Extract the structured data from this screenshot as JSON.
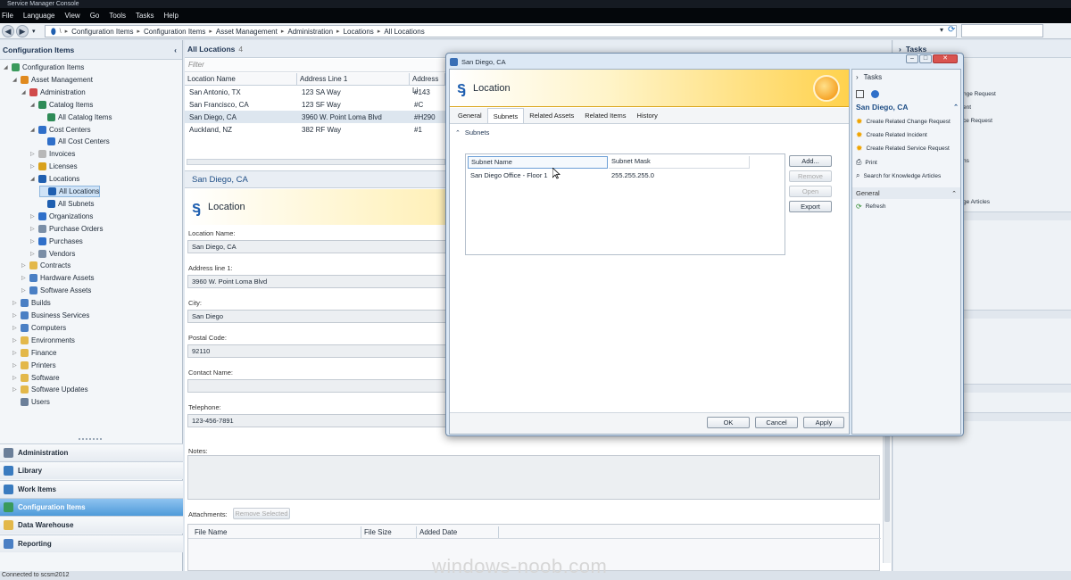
{
  "window": {
    "title": "Service Manager Console"
  },
  "menu": [
    "File",
    "Language",
    "View",
    "Go",
    "Tools",
    "Tasks",
    "Help"
  ],
  "breadcrumb": [
    "Configuration Items",
    "Configuration Items",
    "Asset Management",
    "Administration",
    "Locations",
    "All Locations"
  ],
  "left_pane": {
    "title": "Configuration Items",
    "tree": [
      {
        "label": "Configuration Items",
        "level": 0,
        "icon": "ci-icon"
      },
      {
        "label": "Asset Management",
        "level": 1,
        "icon": "asset-icon"
      },
      {
        "label": "Administration",
        "level": 2,
        "icon": "admin-icon"
      },
      {
        "label": "Catalog Items",
        "level": 3,
        "icon": "catalog-icon"
      },
      {
        "label": "All Catalog Items",
        "level": 4,
        "icon": "catalog-icon"
      },
      {
        "label": "Cost Centers",
        "level": 3,
        "icon": "cost-center-icon"
      },
      {
        "label": "All Cost Centers",
        "level": 4,
        "icon": "cost-center-icon"
      },
      {
        "label": "Invoices",
        "level": 3,
        "icon": "invoice-icon"
      },
      {
        "label": "Licenses",
        "level": 3,
        "icon": "license-icon"
      },
      {
        "label": "Locations",
        "level": 3,
        "icon": "location-icon"
      },
      {
        "label": "All Locations",
        "level": 4,
        "icon": "location-icon",
        "selected": true
      },
      {
        "label": "All Subnets",
        "level": 4,
        "icon": "location-icon"
      },
      {
        "label": "Organizations",
        "level": 3,
        "icon": "organization-icon"
      },
      {
        "label": "Purchase Orders",
        "level": 3,
        "icon": "purchase-order-icon"
      },
      {
        "label": "Purchases",
        "level": 3,
        "icon": "purchase-icon"
      },
      {
        "label": "Vendors",
        "level": 3,
        "icon": "vendor-icon"
      },
      {
        "label": "Contracts",
        "level": 2,
        "icon": "folder-icon"
      },
      {
        "label": "Hardware Assets",
        "level": 2,
        "icon": "hardware-icon"
      },
      {
        "label": "Software Assets",
        "level": 2,
        "icon": "software-asset-icon"
      },
      {
        "label": "Builds",
        "level": 1,
        "icon": "build-icon"
      },
      {
        "label": "Business Services",
        "level": 1,
        "icon": "business-service-icon"
      },
      {
        "label": "Computers",
        "level": 1,
        "icon": "computer-icon"
      },
      {
        "label": "Environments",
        "level": 1,
        "icon": "folder-icon"
      },
      {
        "label": "Finance",
        "level": 1,
        "icon": "folder-icon"
      },
      {
        "label": "Printers",
        "level": 1,
        "icon": "printer-icon"
      },
      {
        "label": "Software",
        "level": 1,
        "icon": "software-icon"
      },
      {
        "label": "Software Updates",
        "level": 1,
        "icon": "update-icon"
      },
      {
        "label": "Users",
        "level": 1,
        "icon": "users-icon"
      }
    ],
    "workspaces": [
      "Administration",
      "Library",
      "Work Items",
      "Configuration Items",
      "Data Warehouse",
      "Reporting"
    ],
    "active_workspace": "Configuration Items"
  },
  "list": {
    "title": "All Locations",
    "count": "4",
    "filter_placeholder": "Filter",
    "columns": [
      "Location Name",
      "Address Line 1",
      "Address Li"
    ],
    "rows": [
      [
        "San Antonio, TX",
        "123 SA Way",
        "#143"
      ],
      [
        "San Francisco, CA",
        "123 SF Way",
        "#C"
      ],
      [
        "San Diego, CA",
        "3960 W. Point Loma Blvd",
        "#H290"
      ],
      [
        "Auckland, NZ",
        "382 RF Way",
        "#1"
      ]
    ],
    "selected_row": 2
  },
  "detail": {
    "heading": "San Diego, CA",
    "banner": "Location",
    "fields": [
      {
        "label": "Location Name:",
        "value": "San Diego, CA"
      },
      {
        "label": "Address line 1:",
        "value": "3960 W. Point Loma Blvd"
      },
      {
        "label": "City:",
        "value": "San Diego"
      },
      {
        "label": "Postal Code:",
        "value": "92110"
      },
      {
        "label": "Contact Name:",
        "value": ""
      },
      {
        "label": "Telephone:",
        "value": "123-456-7891"
      }
    ],
    "notes_label": "Notes:",
    "attachments_label": "Attachments:",
    "remove_selected": "Remove Selected",
    "attachment_columns": [
      "File Name",
      "File Size",
      "Added Date"
    ]
  },
  "right_pane": {
    "title": "Tasks",
    "partial_items": [
      "nge Request",
      "ent",
      "ce Request",
      "ns",
      "ge Articles"
    ]
  },
  "dialog": {
    "title": "San Diego, CA",
    "banner": "Location",
    "tabs": [
      "General",
      "Subnets",
      "Related Assets",
      "Related Items",
      "History"
    ],
    "active_tab": "Subnets",
    "section": "Subnets",
    "columns": [
      "Subnet Name",
      "Subnet Mask"
    ],
    "rows": [
      [
        "San Diego Office - Floor 1",
        "255.255.255.0"
      ]
    ],
    "side_buttons": [
      "Add...",
      "Remove",
      "Open",
      "Export"
    ],
    "footer_buttons": [
      "OK",
      "Cancel",
      "Apply"
    ],
    "tasks": {
      "title": "Tasks",
      "context": "San Diego, CA",
      "items": [
        "Create Related Change Request",
        "Create Related Incident",
        "Create Related Service Request",
        "Print",
        "Search for Knowledge Articles"
      ],
      "general_title": "General",
      "general_items": [
        "Refresh"
      ]
    }
  },
  "status": "Connected to scsm2012",
  "watermark": "windows-noob.com"
}
